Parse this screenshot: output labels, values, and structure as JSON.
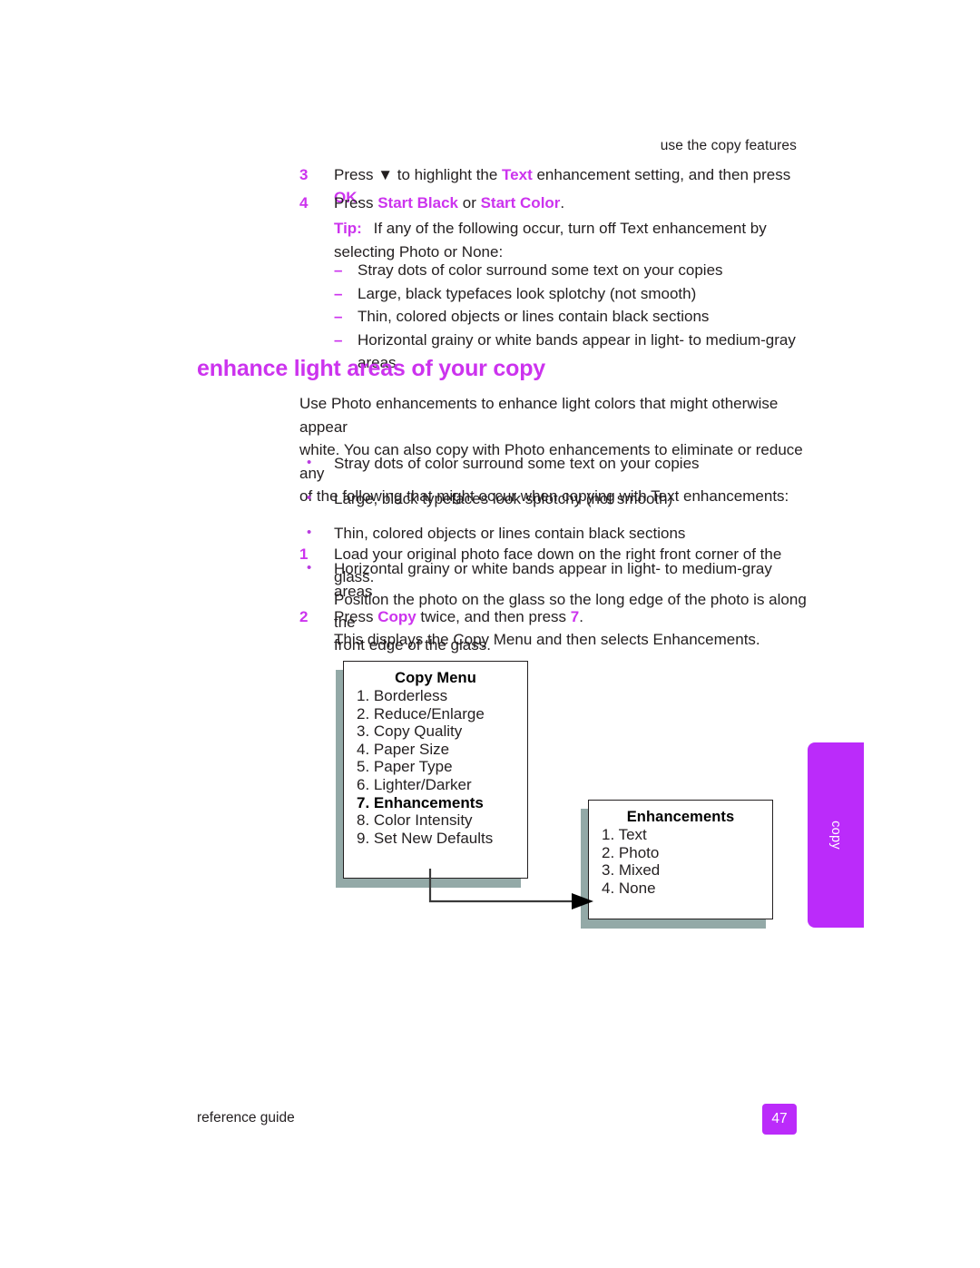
{
  "header": {
    "running_head": "use the copy features"
  },
  "steps_top": [
    {
      "number": "3",
      "segments": [
        {
          "t": "Press ",
          "style": "plain"
        },
        {
          "t": "▼",
          "style": "glyph"
        },
        {
          "t": " to highlight the ",
          "style": "plain"
        },
        {
          "t": "Text",
          "style": "magenta-bold"
        },
        {
          "t": " enhancement setting, and then press ",
          "style": "plain"
        },
        {
          "t": "OK",
          "style": "magenta-bold"
        },
        {
          "t": ".",
          "style": "plain"
        }
      ],
      "plain_text": "Press ▼ to highlight the Text enhancement setting, and then press OK."
    },
    {
      "number": "4",
      "plain_text": "Press Start Black or Start Color."
    }
  ],
  "tip": {
    "label": "Tip:",
    "line1": "If any of the following occur, turn off Text enhancement by",
    "line2": "selecting Photo or None:"
  },
  "dash_list": {
    "marker": "–",
    "items": [
      "Stray dots of color surround some text on your copies",
      "Large, black typefaces look splotchy (not smooth)",
      "Thin, colored objects or lines contain black sections",
      "Horizontal grainy or white bands appear in light- to medium-gray areas"
    ]
  },
  "section": {
    "heading": "enhance light areas of your copy",
    "paragraph_lines": [
      "Use Photo enhancements to enhance light colors that might otherwise appear",
      "white. You can also copy with Photo enhancements to eliminate or reduce any",
      "of the following that might occur when copying with Text enhancements:"
    ]
  },
  "bullet_list": {
    "marker": "•",
    "items": [
      "Stray dots of color surround some text on your copies",
      "Large, black typefaces look splotchy (not smooth)",
      "Thin, colored objects or lines contain black sections",
      "Horizontal grainy or white bands appear in light- to medium-gray areas"
    ]
  },
  "steps_bottom": [
    {
      "number": "1",
      "line1": "Load your original photo face down on the right front corner of the glass.",
      "line2": "Position the photo on the glass so the long edge of the photo is along the",
      "line3": "front edge of the glass."
    },
    {
      "number": "2",
      "line1_pre": "Press ",
      "line1_kw": "Copy",
      "line1_mid": " twice, and then press ",
      "line1_key": "7",
      "line1_post": ".",
      "line2": "This displays the Copy Menu and then selects Enhancements."
    }
  ],
  "diagram": {
    "copy_menu": {
      "title": "Copy Menu",
      "items": [
        "1. Borderless",
        "2. Reduce/Enlarge",
        "3. Copy Quality",
        "4. Paper Size",
        "5. Paper Type",
        "6. Lighter/Darker",
        "7. Enhancements",
        "8. Color Intensity",
        "9. Set New Defaults"
      ],
      "selected_index": 6
    },
    "enhancements": {
      "title": "Enhancements",
      "items": [
        "1. Text",
        "2. Photo",
        "3. Mixed",
        "4. None"
      ]
    }
  },
  "side_tab": {
    "label": "copy"
  },
  "footer": {
    "left": "reference guide",
    "page": "47"
  },
  "colors": {
    "magenta": "#CC33EE",
    "tab_purple": "#BB2BFA",
    "screen_shadow": "#93a9a7",
    "text": "#231f20"
  }
}
